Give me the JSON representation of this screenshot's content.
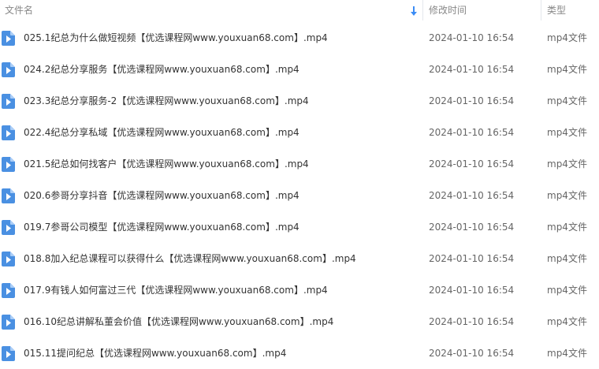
{
  "header": {
    "name_label": "文件名",
    "time_label": "修改时间",
    "type_label": "类型"
  },
  "colors": {
    "icon_blue": "#4a90e2",
    "sort_arrow": "#3b8cf5"
  },
  "icons": {
    "file": "video-file-icon",
    "sort": "sort-descending-icon"
  },
  "files": [
    {
      "name": "025.1纪总为什么做短视频【优选课程网www.youxuan68.com】.mp4",
      "time": "2024-01-10 16:54",
      "type": "mp4文件"
    },
    {
      "name": "024.2纪总分享服务【优选课程网www.youxuan68.com】.mp4",
      "time": "2024-01-10 16:54",
      "type": "mp4文件"
    },
    {
      "name": "023.3纪总分享服务-2【优选课程网www.youxuan68.com】.mp4",
      "time": "2024-01-10 16:54",
      "type": "mp4文件"
    },
    {
      "name": "022.4纪总分享私域【优选课程网www.youxuan68.com】.mp4",
      "time": "2024-01-10 16:54",
      "type": "mp4文件"
    },
    {
      "name": "021.5纪总如何找客户【优选课程网www.youxuan68.com】.mp4",
      "time": "2024-01-10 16:54",
      "type": "mp4文件"
    },
    {
      "name": "020.6参哥分享抖音【优选课程网www.youxuan68.com】.mp4",
      "time": "2024-01-10 16:54",
      "type": "mp4文件"
    },
    {
      "name": "019.7参哥公司模型【优选课程网www.youxuan68.com】.mp4",
      "time": "2024-01-10 16:54",
      "type": "mp4文件"
    },
    {
      "name": "018.8加入纪总课程可以获得什么【优选课程网www.youxuan68.com】.mp4",
      "time": "2024-01-10 16:54",
      "type": "mp4文件"
    },
    {
      "name": "017.9有钱人如何富过三代【优选课程网www.youxuan68.com】.mp4",
      "time": "2024-01-10 16:54",
      "type": "mp4文件"
    },
    {
      "name": "016.10纪总讲解私董会价值【优选课程网www.youxuan68.com】.mp4",
      "time": "2024-01-10 16:54",
      "type": "mp4文件"
    },
    {
      "name": "015.11提问纪总【优选课程网www.youxuan68.com】.mp4",
      "time": "2024-01-10 16:54",
      "type": "mp4文件"
    }
  ]
}
